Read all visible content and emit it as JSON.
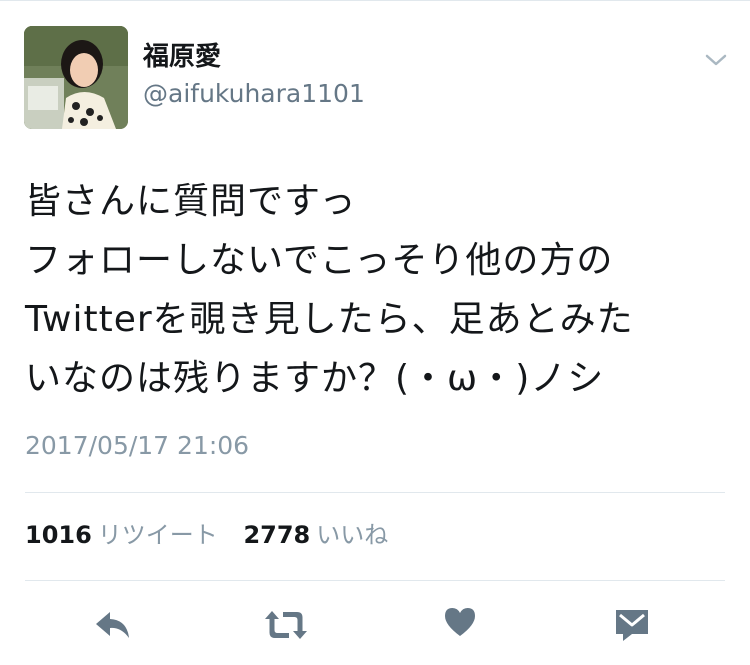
{
  "user": {
    "display_name": "福原愛",
    "handle": "@aifukuhara1101"
  },
  "tweet": {
    "lines": [
      "皆さんに質問ですっ",
      "フォローしないでこっそり他の方の",
      "Twitterを覗き見したら、足あとみた",
      "いなのは残りますか？(・ω・)ノシ"
    ],
    "timestamp": "2017/05/17 21:06"
  },
  "stats": {
    "retweets_count": "1016",
    "retweets_label": "リツイート",
    "likes_count": "2778",
    "likes_label": "いいね"
  },
  "actions": {
    "icons": [
      "reply-icon",
      "retweet-icon",
      "like-icon",
      "direct-message-icon"
    ]
  },
  "colors": {
    "text": "#14171a",
    "secondary": "#657786",
    "muted": "#8899a6",
    "icon": "#657786",
    "divider": "#e1e8ed"
  }
}
